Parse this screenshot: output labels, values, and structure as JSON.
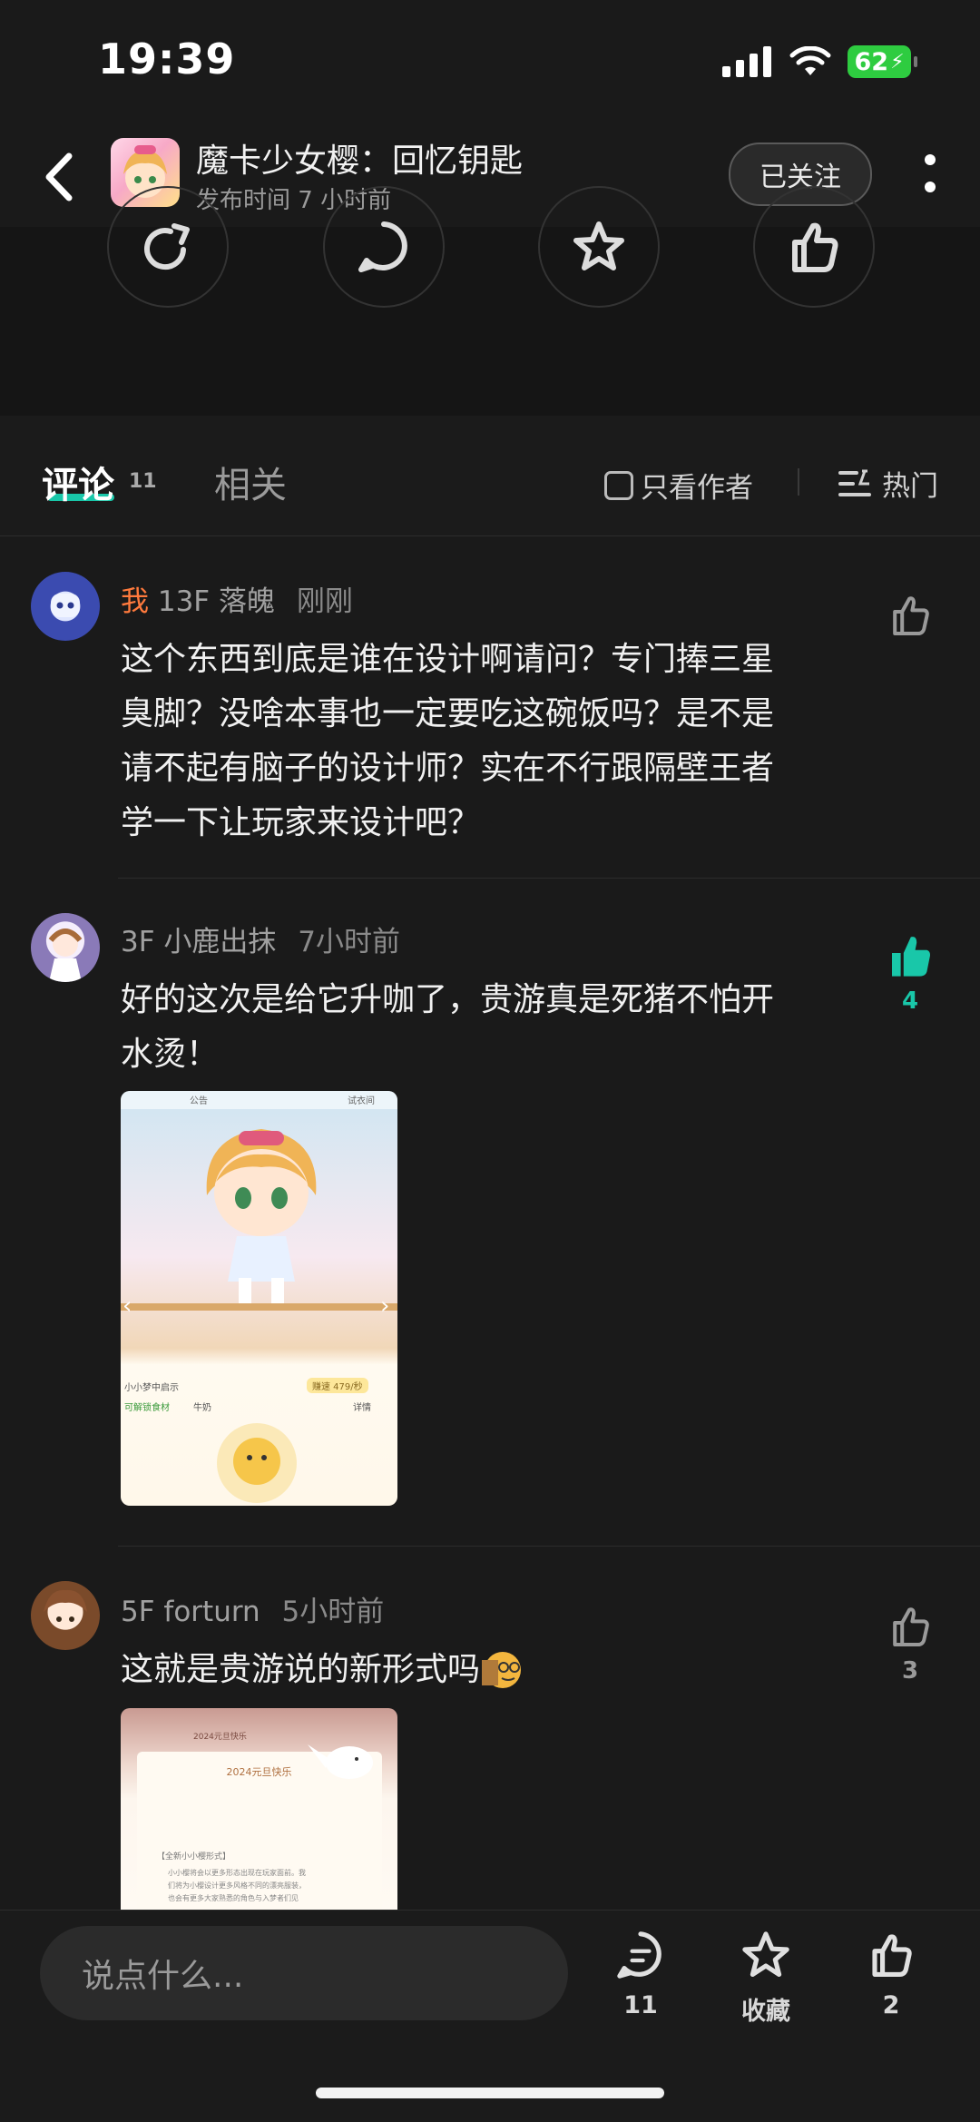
{
  "status": {
    "time": "19:39",
    "battery": "62"
  },
  "header": {
    "title": "魔卡少女樱：回忆钥匙",
    "subtitle": "发布时间 7 小时前",
    "follow_label": "已关注"
  },
  "tabs": {
    "comments_label": "评论",
    "comments_count": "11",
    "related_label": "相关",
    "author_only_label": "只看作者",
    "sort_label": "热门"
  },
  "comments": [
    {
      "me_tag": "我",
      "floor_user": "13F 落魄",
      "time": "刚刚",
      "lines": [
        "这个东西到底是谁在设计啊请问？专门捧三星",
        "臭脚？没啥本事也一定要吃这碗饭吗？是不是",
        "请不起有脑子的设计师？实在不行跟隔壁王者",
        "学一下让玩家来设计吧？"
      ],
      "likes": ""
    },
    {
      "floor_user": "3F 小鹿出抹",
      "time": "7小时前",
      "lines": [
        "好的这次是给它升咖了，贵游真是死猪不怕开",
        "水烫！"
      ],
      "likes": "4"
    },
    {
      "floor_user": "5F forturn",
      "time": "5小时前",
      "lines": [
        "这就是贵游说的新形式吗"
      ],
      "likes": "3"
    }
  ],
  "image1": {
    "top_left": "公告",
    "top_right": "试衣间",
    "row1": "小小梦中启示",
    "row1_right": "赚速 479/秒",
    "row2": "可解锁食材",
    "row2_item": "牛奶",
    "row2_right": "详情"
  },
  "image2": {
    "header": "2024元旦快乐",
    "title": "2024元旦快乐",
    "line1": "【全新小小樱形式】",
    "line2": "小小樱将会以更多形态出现在玩家面前。我",
    "line3": "们将为小樱设计更多风格不同的漂亮服装，",
    "line4": "也会有更多大家熟悉的角色与入梦者们见"
  },
  "bottom": {
    "input_placeholder": "说点什么...",
    "comment_count": "11",
    "collect_label": "收藏",
    "like_count": "2"
  },
  "colors": {
    "accent": "#19c7a9",
    "me_tag": "#ff7a3d",
    "background": "#1a1a1a"
  }
}
